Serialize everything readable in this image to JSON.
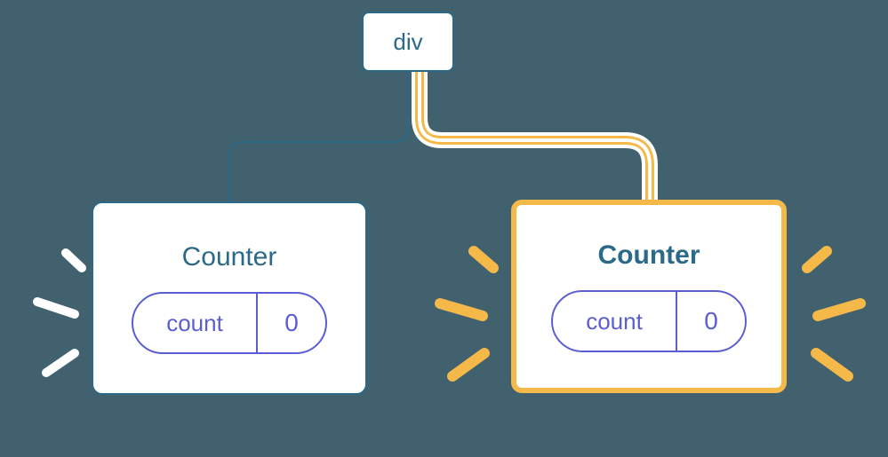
{
  "root": {
    "label": "div"
  },
  "children": {
    "left": {
      "title": "Counter",
      "pill_label": "count",
      "pill_value": "0"
    },
    "right": {
      "title": "Counter",
      "pill_label": "count",
      "pill_value": "0"
    }
  },
  "colors": {
    "background": "#42616e",
    "node_border": "#2a6a88",
    "highlight": "#f5b94a",
    "pill": "#5b5ed0",
    "burst_white": "#ffffff"
  }
}
